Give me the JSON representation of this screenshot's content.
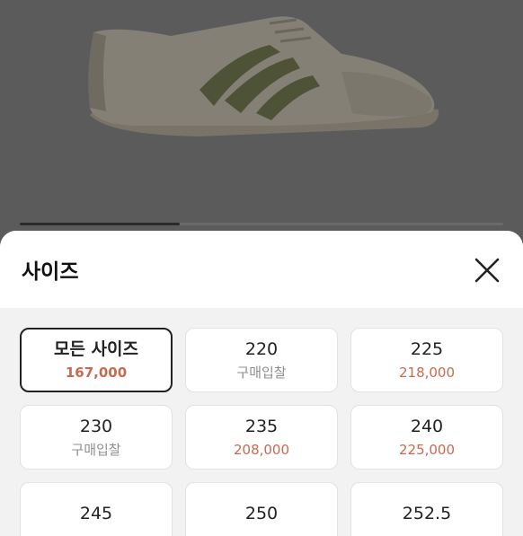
{
  "sheet": {
    "title": "사이즈"
  },
  "carousel": {
    "progress": 0.33
  },
  "sizes": [
    {
      "label": "모든 사이즈",
      "price": "167,000",
      "selected": true,
      "price_kind": "price"
    },
    {
      "label": "220",
      "price": "구매입찰",
      "selected": false,
      "price_kind": "bid"
    },
    {
      "label": "225",
      "price": "218,000",
      "selected": false,
      "price_kind": "price"
    },
    {
      "label": "230",
      "price": "구매입찰",
      "selected": false,
      "price_kind": "bid"
    },
    {
      "label": "235",
      "price": "208,000",
      "selected": false,
      "price_kind": "price"
    },
    {
      "label": "240",
      "price": "225,000",
      "selected": false,
      "price_kind": "price"
    },
    {
      "label": "245",
      "price": "",
      "selected": false,
      "price_kind": "price"
    },
    {
      "label": "250",
      "price": "",
      "selected": false,
      "price_kind": "price"
    },
    {
      "label": "252.5",
      "price": "",
      "selected": false,
      "price_kind": "bid"
    }
  ],
  "colors": {
    "price": "#c76a50",
    "bid": "#8f8f8f",
    "overlay": "#5a5a5a"
  },
  "icons": {
    "close": "close-icon",
    "product": "sneaker-image"
  }
}
